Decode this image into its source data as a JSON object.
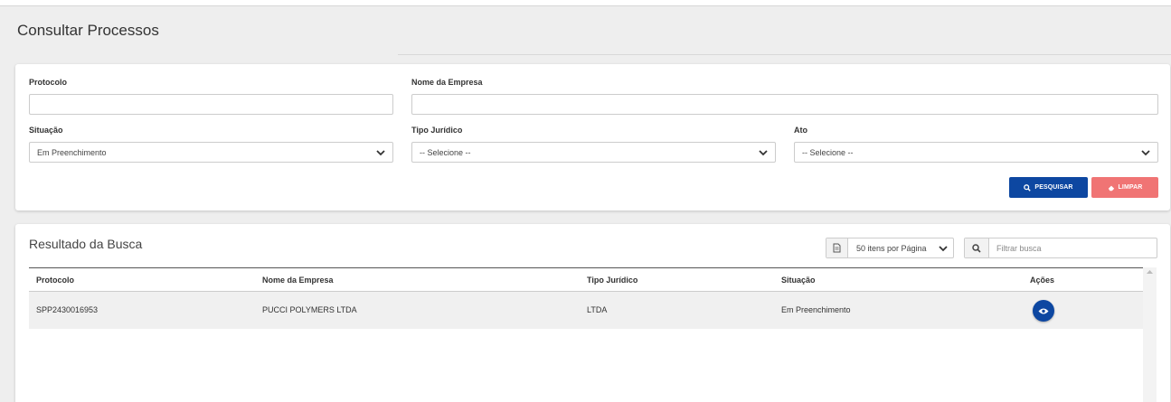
{
  "page": {
    "title": "Consultar Processos"
  },
  "filters": {
    "protocolo": {
      "label": "Protocolo",
      "value": ""
    },
    "nome_empresa": {
      "label": "Nome da Empresa",
      "value": ""
    },
    "situacao": {
      "label": "Situação",
      "value": "Em Preenchimento"
    },
    "tipo_juridico": {
      "label": "Tipo Jurídico",
      "value": "-- Selecione --"
    },
    "ato": {
      "label": "Ato",
      "value": "-- Selecione --"
    },
    "search_button": "PESQUISAR",
    "clear_button": "LIMPAR"
  },
  "results": {
    "title": "Resultado da Busca",
    "per_page": "50 itens por Página",
    "filter_placeholder": "Filtrar busca",
    "columns": [
      "Protocolo",
      "Nome da Empresa",
      "Tipo Jurídico",
      "Situação",
      "Ações"
    ],
    "rows": [
      {
        "protocolo": "SPP2430016953",
        "nome_empresa": "PUCCI POLYMERS LTDA",
        "tipo_juridico": "LTDA",
        "situacao": "Em Preenchimento",
        "acao_icon": "eye-icon"
      }
    ]
  },
  "colors": {
    "primary": "#0d47a1",
    "danger": "#f07474",
    "background": "#eeeeee"
  }
}
